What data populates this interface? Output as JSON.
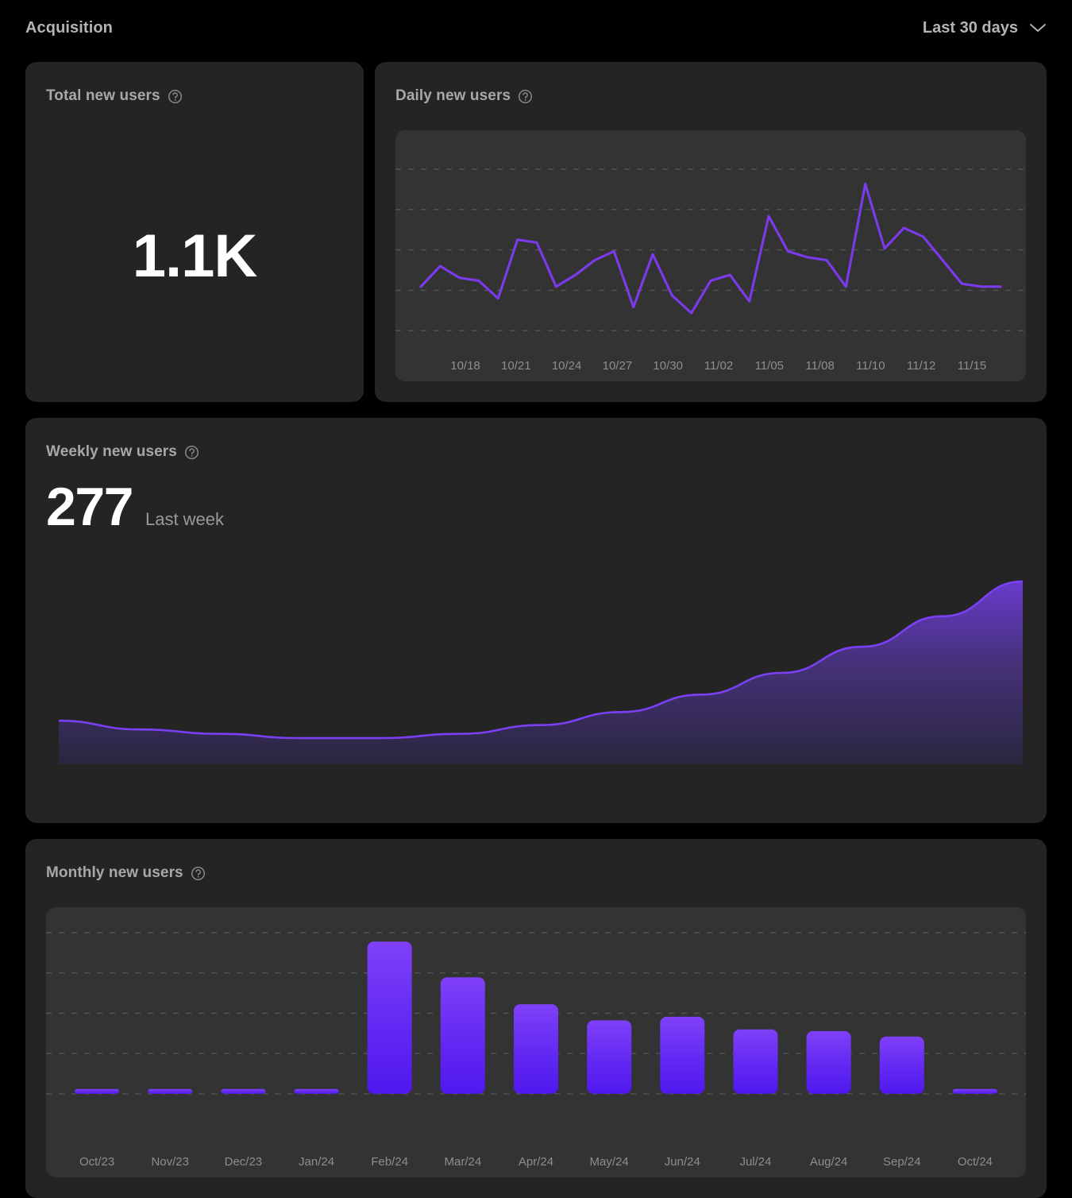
{
  "header": {
    "title": "Acquisition",
    "range_label": "Last 30 days",
    "chevron_icon": "chevron-down-icon"
  },
  "colors": {
    "page_background": "#000000",
    "card_background": "#242424",
    "chart_panel_background": "#333333",
    "accent_line": "#7c3aed",
    "accent_bar_top": "#7c3ff5",
    "accent_bar_bottom": "#5320ee",
    "gridline": "#6b6b6b",
    "title_text": "#a8a8a8",
    "value_text": "#ffffff",
    "muted_text": "#8e8e8e"
  },
  "cards": {
    "total": {
      "title": "Total new users",
      "help_icon": "help-circle-icon",
      "value": "1.1K"
    },
    "daily": {
      "title": "Daily new users",
      "help_icon": "help-circle-icon"
    },
    "weekly": {
      "title": "Weekly new users",
      "help_icon": "help-circle-icon",
      "value": "277",
      "subtitle": "Last week"
    },
    "monthly": {
      "title": "Monthly new users",
      "help_icon": "help-circle-icon"
    }
  },
  "chart_data": [
    {
      "id": "daily-new-users",
      "type": "line",
      "title": "Daily new users",
      "xlabel": "",
      "ylabel": "",
      "grid": true,
      "gridlines": 5,
      "legend": false,
      "ylim": [
        0,
        100
      ],
      "tick_labels": [
        "10/18",
        "10/21",
        "10/24",
        "10/27",
        "10/30",
        "11/02",
        "11/05",
        "11/08",
        "11/10",
        "11/12",
        "11/15"
      ],
      "x": [
        "10/16",
        "10/17",
        "10/18",
        "10/19",
        "10/20",
        "10/21",
        "10/22",
        "10/23",
        "10/24",
        "10/25",
        "10/26",
        "10/27",
        "10/28",
        "10/29",
        "10/30",
        "10/31",
        "11/01",
        "11/02",
        "11/03",
        "11/04",
        "11/05",
        "11/06",
        "11/07",
        "11/08",
        "11/09",
        "11/10",
        "11/11",
        "11/12",
        "11/13",
        "11/14",
        "11/15"
      ],
      "values": [
        50,
        57,
        53,
        52,
        46,
        66,
        65,
        50,
        54,
        59,
        62,
        43,
        61,
        47,
        41,
        52,
        54,
        45,
        74,
        62,
        60,
        59,
        50,
        85,
        63,
        70,
        67,
        59,
        51,
        50,
        50
      ]
    },
    {
      "id": "weekly-new-users",
      "type": "area",
      "title": "Weekly new users",
      "xlabel": "",
      "ylabel": "",
      "grid": false,
      "legend": false,
      "latest_value": 277,
      "latest_label": "Last week",
      "values": [
        68,
        66,
        65,
        64,
        64,
        65,
        67,
        70,
        74,
        79,
        85,
        92,
        100
      ]
    },
    {
      "id": "monthly-new-users",
      "type": "bar",
      "title": "Monthly new users",
      "xlabel": "",
      "ylabel": "",
      "grid": true,
      "gridlines": 5,
      "legend": false,
      "ylim": [
        0,
        100
      ],
      "categories": [
        "Oct/23",
        "Nov/23",
        "Dec/23",
        "Jan/24",
        "Feb/24",
        "Mar/24",
        "Apr/24",
        "May/24",
        "Jun/24",
        "Jul/24",
        "Aug/24",
        "Sep/24",
        "Oct/24"
      ],
      "values": [
        1,
        1,
        1,
        1,
        85,
        65,
        50,
        41,
        43,
        36,
        35,
        32,
        1
      ]
    }
  ]
}
